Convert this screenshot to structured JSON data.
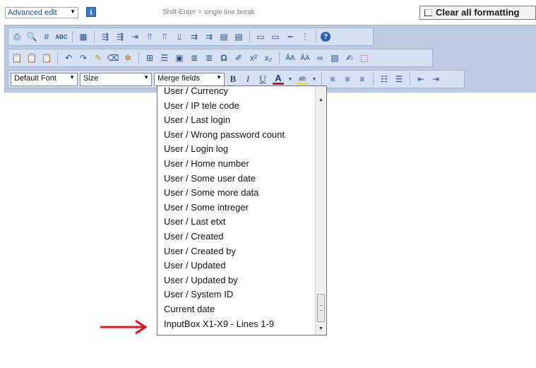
{
  "topbar": {
    "mode_label": "Advanced edit",
    "hint": "Shift-Enter = single line break",
    "clear_label": "Clear all formatting"
  },
  "toolbar": {
    "font_label": "Default Font",
    "size_label": "Size",
    "merge_label": "Merge fields",
    "bold": "B",
    "italic": "I",
    "underline": "U",
    "font_color": "A",
    "highlight": "ab",
    "row1_icons": [
      "print-icon",
      "preview-icon",
      "find-icon",
      "spellcheck-icon",
      "table-icon",
      "insert-row-before-icon",
      "insert-row-after-icon",
      "delete-row-icon",
      "insert-col-before-icon",
      "insert-col-after-icon",
      "delete-col-icon",
      "split-cell-icon",
      "merge-cells-icon",
      "cell-props-icon",
      "table-props-icon",
      "table-delete-icon",
      "hr-icon",
      "separator-icon",
      "help-icon"
    ],
    "row2_icons": [
      "paste-icon",
      "paste-text-icon",
      "paste-word-icon",
      "undo-icon",
      "redo-icon",
      "cleanup-icon",
      "eraser-icon",
      "remove-format-icon",
      "template-icon",
      "line-icon",
      "image-icon",
      "paragraph-icon",
      "special-char-icon",
      "emoticon-icon",
      "superscript-icon",
      "subscript-icon",
      "font-up-icon",
      "font-down-icon",
      "link-icon",
      "image-manager-icon",
      "edit-icon",
      "pdf-icon"
    ],
    "row3_icons": [
      "align-left-icon",
      "align-center-icon",
      "align-right-icon",
      "ordered-list-icon",
      "unordered-list-icon",
      "outdent-icon",
      "indent-icon"
    ]
  },
  "merge_dropdown": {
    "items": [
      "User / Currency",
      "User / IP tele code",
      "User / Last login",
      "User / Wrong password count",
      "User / Login log",
      "User / Home number",
      "User / Some user date",
      "User / Some more data",
      "User / Some intreger",
      "User / Last etxt",
      "User / Created",
      "User / Created by",
      "User / Updated",
      "User / Updated by",
      "User / System ID",
      "Current date",
      "InputBox X1-X9 - Lines 1-9"
    ]
  },
  "colors": {
    "toolbar_bg": "#bccbe2",
    "toolbar_row": "#d6e2f3",
    "arrow": "#e8141a",
    "font_color_bar": "#e01010",
    "highlight_bar": "#ffe400"
  }
}
